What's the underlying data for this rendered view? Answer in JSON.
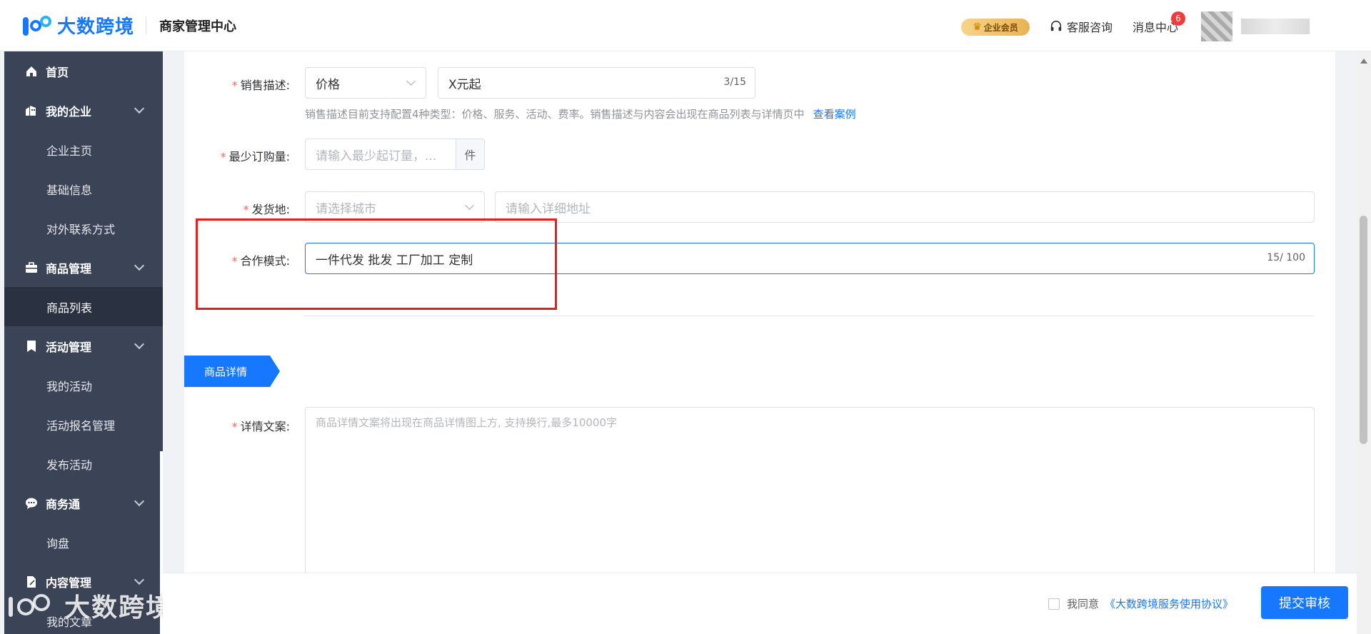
{
  "header": {
    "brand_name": "大数跨境",
    "app_title": "商家管理中心",
    "vip_label": "企业会员",
    "service_label": "客服咨询",
    "message_label": "消息中心",
    "message_count": "6"
  },
  "sidebar": {
    "items": [
      {
        "type": "group",
        "label": "首页",
        "icon": "home-icon"
      },
      {
        "type": "group",
        "label": "我的企业",
        "icon": "company-icon"
      },
      {
        "type": "sub",
        "label": "企业主页"
      },
      {
        "type": "sub",
        "label": "基础信息"
      },
      {
        "type": "sub",
        "label": "对外联系方式"
      },
      {
        "type": "group",
        "label": "商品管理",
        "icon": "briefcase-icon"
      },
      {
        "type": "sub",
        "label": "商品列表",
        "active": true
      },
      {
        "type": "group",
        "label": "活动管理",
        "icon": "bookmark-icon"
      },
      {
        "type": "sub",
        "label": "我的活动"
      },
      {
        "type": "sub",
        "label": "活动报名管理"
      },
      {
        "type": "sub",
        "label": "发布活动"
      },
      {
        "type": "group",
        "label": "商务通",
        "icon": "chat-icon"
      },
      {
        "type": "sub",
        "label": "询盘"
      },
      {
        "type": "group",
        "label": "内容管理",
        "icon": "document-icon"
      },
      {
        "type": "sub",
        "label": "我的文章"
      }
    ],
    "watermark_text": "大数跨境"
  },
  "form": {
    "sales_desc": {
      "label": "销售描述:",
      "type_value": "价格",
      "text_value": "X元起",
      "counter": "3/15",
      "hint": "销售描述目前支持配置4种类型：价格、服务、活动、费率。销售描述与内容会出现在商品列表与详情页中",
      "hint_link": "查看案例"
    },
    "min_order": {
      "label": "最少订购量:",
      "placeholder": "请输入最少起订量，...",
      "unit": "件"
    },
    "ship_from": {
      "label": "发货地:",
      "city_placeholder": "请选择城市",
      "address_placeholder": "请输入详细地址"
    },
    "coop_mode": {
      "label": "合作模式:",
      "value": "一件代发 批发 工厂加工 定制",
      "counter": "15/ 100"
    },
    "details_section": {
      "tag": "商品详情",
      "label": "详情文案:",
      "placeholder": "商品详情文案将出现在商品详情图上方, 支持换行,最多10000字"
    }
  },
  "footer": {
    "agree_text": "我同意",
    "protocol_text": "《大数跨境服务使用协议》",
    "submit_label": "提交审核"
  },
  "colors": {
    "primary": "#1677ff",
    "sidebar_bg": "#3b4456",
    "sidebar_active": "#2a3140",
    "required": "#f56c6c",
    "highlight": "#ee1b1b"
  }
}
